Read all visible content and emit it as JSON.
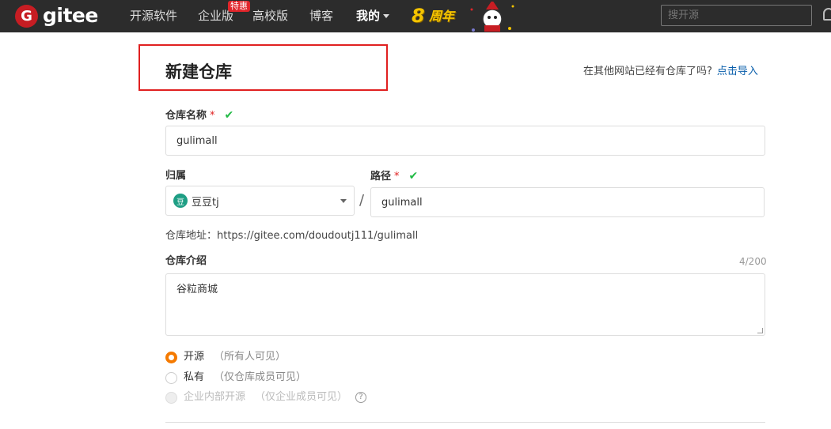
{
  "navbar": {
    "logo_mark": "G",
    "logo_text": "gitee",
    "items": [
      {
        "label": "开源软件"
      },
      {
        "label": "企业版"
      },
      {
        "label": "高校版"
      },
      {
        "label": "博客"
      },
      {
        "label": "我的"
      }
    ],
    "badge": "特惠",
    "anniversary": {
      "number": "8",
      "text": "周年"
    },
    "search_placeholder": "搜开源"
  },
  "page": {
    "title": "新建仓库",
    "import_tip": "在其他网站已经有仓库了吗?",
    "import_link": "点击导入"
  },
  "form": {
    "repo_name": {
      "label": "仓库名称",
      "required_mark": "*",
      "valid_mark": "✔",
      "value": "gulimall"
    },
    "owner": {
      "label": "归属",
      "avatar_text": "豆",
      "value": "豆豆tj"
    },
    "separator": "/",
    "path": {
      "label": "路径",
      "required_mark": "*",
      "valid_mark": "✔",
      "value": "gulimall"
    },
    "repo_address": "仓库地址：https://gitee.com/doudoutj111/gulimall",
    "description": {
      "label": "仓库介绍",
      "counter": "4/200",
      "value": "谷粒商城"
    },
    "visibility": [
      {
        "label": "开源",
        "hint": "（所有人可见）",
        "checked": true
      },
      {
        "label": "私有",
        "hint": "（仅仓库成员可见）",
        "checked": false
      },
      {
        "label": "企业内部开源",
        "hint": "（仅企业成员可见）",
        "disabled": true
      }
    ],
    "help_icon": "?"
  },
  "colors": {
    "accent": "#f57a00",
    "link": "#095eab",
    "valid": "#21ba45",
    "highlight": "#e02020",
    "navbar_bg": "#2c2c2c"
  }
}
